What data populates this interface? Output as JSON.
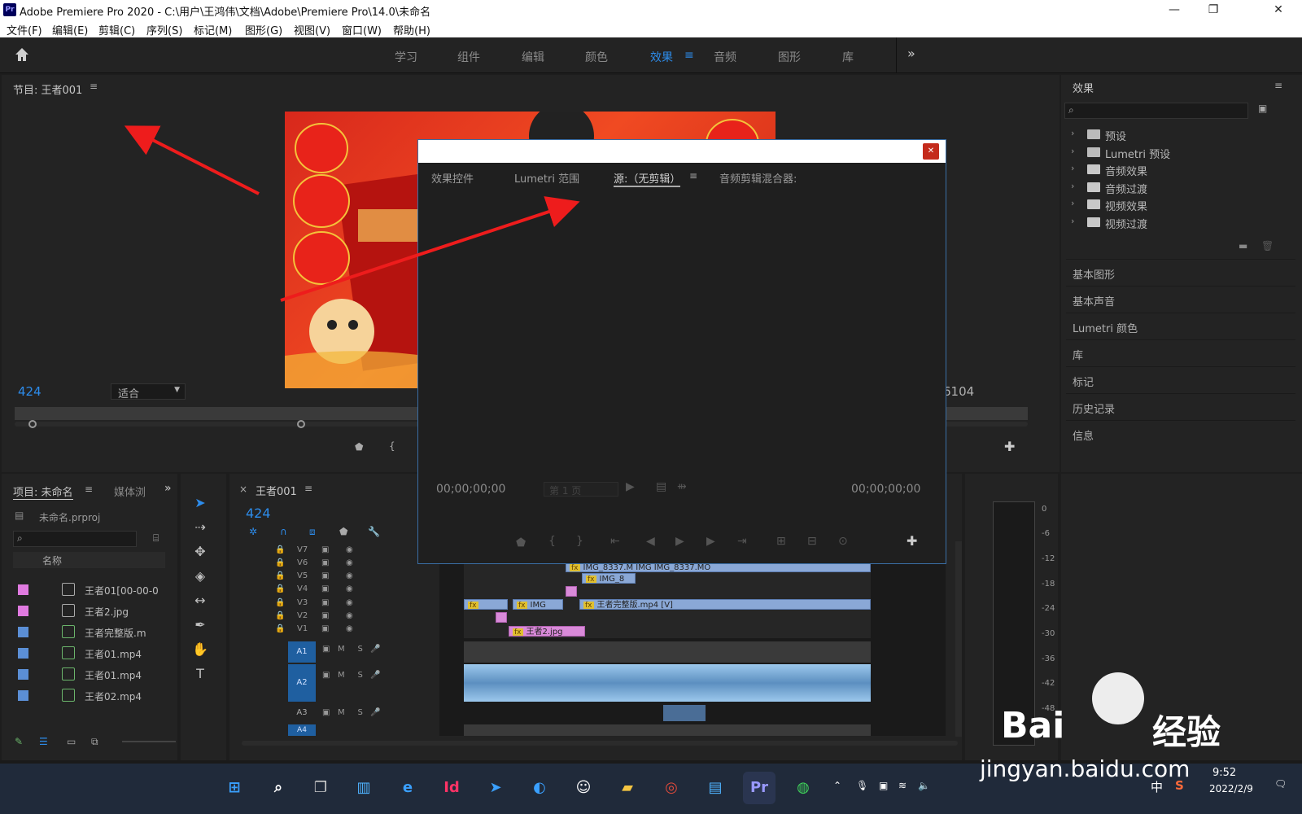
{
  "window": {
    "title": "Adobe Premiere Pro 2020 - C:\\用户\\王鸿伟\\文档\\Adobe\\Premiere Pro\\14.0\\未命名",
    "app_icon": "Pr",
    "min": "—",
    "max": "❐",
    "close": "✕"
  },
  "menu": [
    "文件(F)",
    "编辑(E)",
    "剪辑(C)",
    "序列(S)",
    "标记(M)",
    "图形(G)",
    "视图(V)",
    "窗口(W)",
    "帮助(H)"
  ],
  "workspaces": {
    "items": [
      "学习",
      "组件",
      "编辑",
      "颜色",
      "效果",
      "音频",
      "图形",
      "库"
    ],
    "active": "效果",
    "more": "»"
  },
  "program": {
    "title": "节目: 王者001",
    "timecode": "424",
    "fit": "适合",
    "end_tc": "6104"
  },
  "effects_panel": {
    "title": "效果",
    "tree": [
      "预设",
      "Lumetri 预设",
      "音频效果",
      "音频过渡",
      "视频效果",
      "视频过渡"
    ],
    "sections": [
      "基本图形",
      "基本声音",
      "Lumetri 颜色",
      "库",
      "标记",
      "历史记录",
      "信息"
    ]
  },
  "dialog": {
    "tabs": [
      "效果控件",
      "Lumetri 范围",
      "源:（无剪辑）",
      "音频剪辑混合器:"
    ],
    "tc_left": "00;00;00;00",
    "tc_right": "00;00;00;00",
    "page": "第 1 页"
  },
  "project": {
    "tab": "项目: 未命名",
    "tab2": "媒体浏",
    "file": "未命名.prproj",
    "col": "名称",
    "items": [
      {
        "name": "王者01[00-00-0",
        "color": "#e07ae0"
      },
      {
        "name": "王者2.jpg",
        "color": "#e07ae0"
      },
      {
        "name": "王者完整版.m",
        "color": "#5b8fd6"
      },
      {
        "name": "王者01.mp4",
        "color": "#5b8fd6"
      },
      {
        "name": "王者01.mp4",
        "color": "#5b8fd6"
      },
      {
        "name": "王者02.mp4",
        "color": "#5b8fd6"
      }
    ]
  },
  "timeline": {
    "tab": "王者001",
    "timecode": "424",
    "vtracks": [
      "V7",
      "V6",
      "V5",
      "V4",
      "V3",
      "V2",
      "V1"
    ],
    "atracks": [
      "A1",
      "A2",
      "A3",
      "A4"
    ],
    "clips": {
      "v6a": "IMG_8337.M",
      "v6b": "IMG",
      "v6c": "IMG_8337.MO",
      "v5": "IMG_8",
      "v3a": "IMG",
      "v3b": "王者完整版.mp4 [V]",
      "v1": "王者2.jpg"
    },
    "meter": [
      "0",
      "-6",
      "-12",
      "-18",
      "-24",
      "-30",
      "-36",
      "-42",
      "-48"
    ]
  },
  "taskbar": {
    "time": "9:52",
    "date": "2022/2/9",
    "ime": "中"
  },
  "watermark": {
    "brand": "Bai",
    "brand2": "经验",
    "url": "jingyan.baidu.com"
  }
}
